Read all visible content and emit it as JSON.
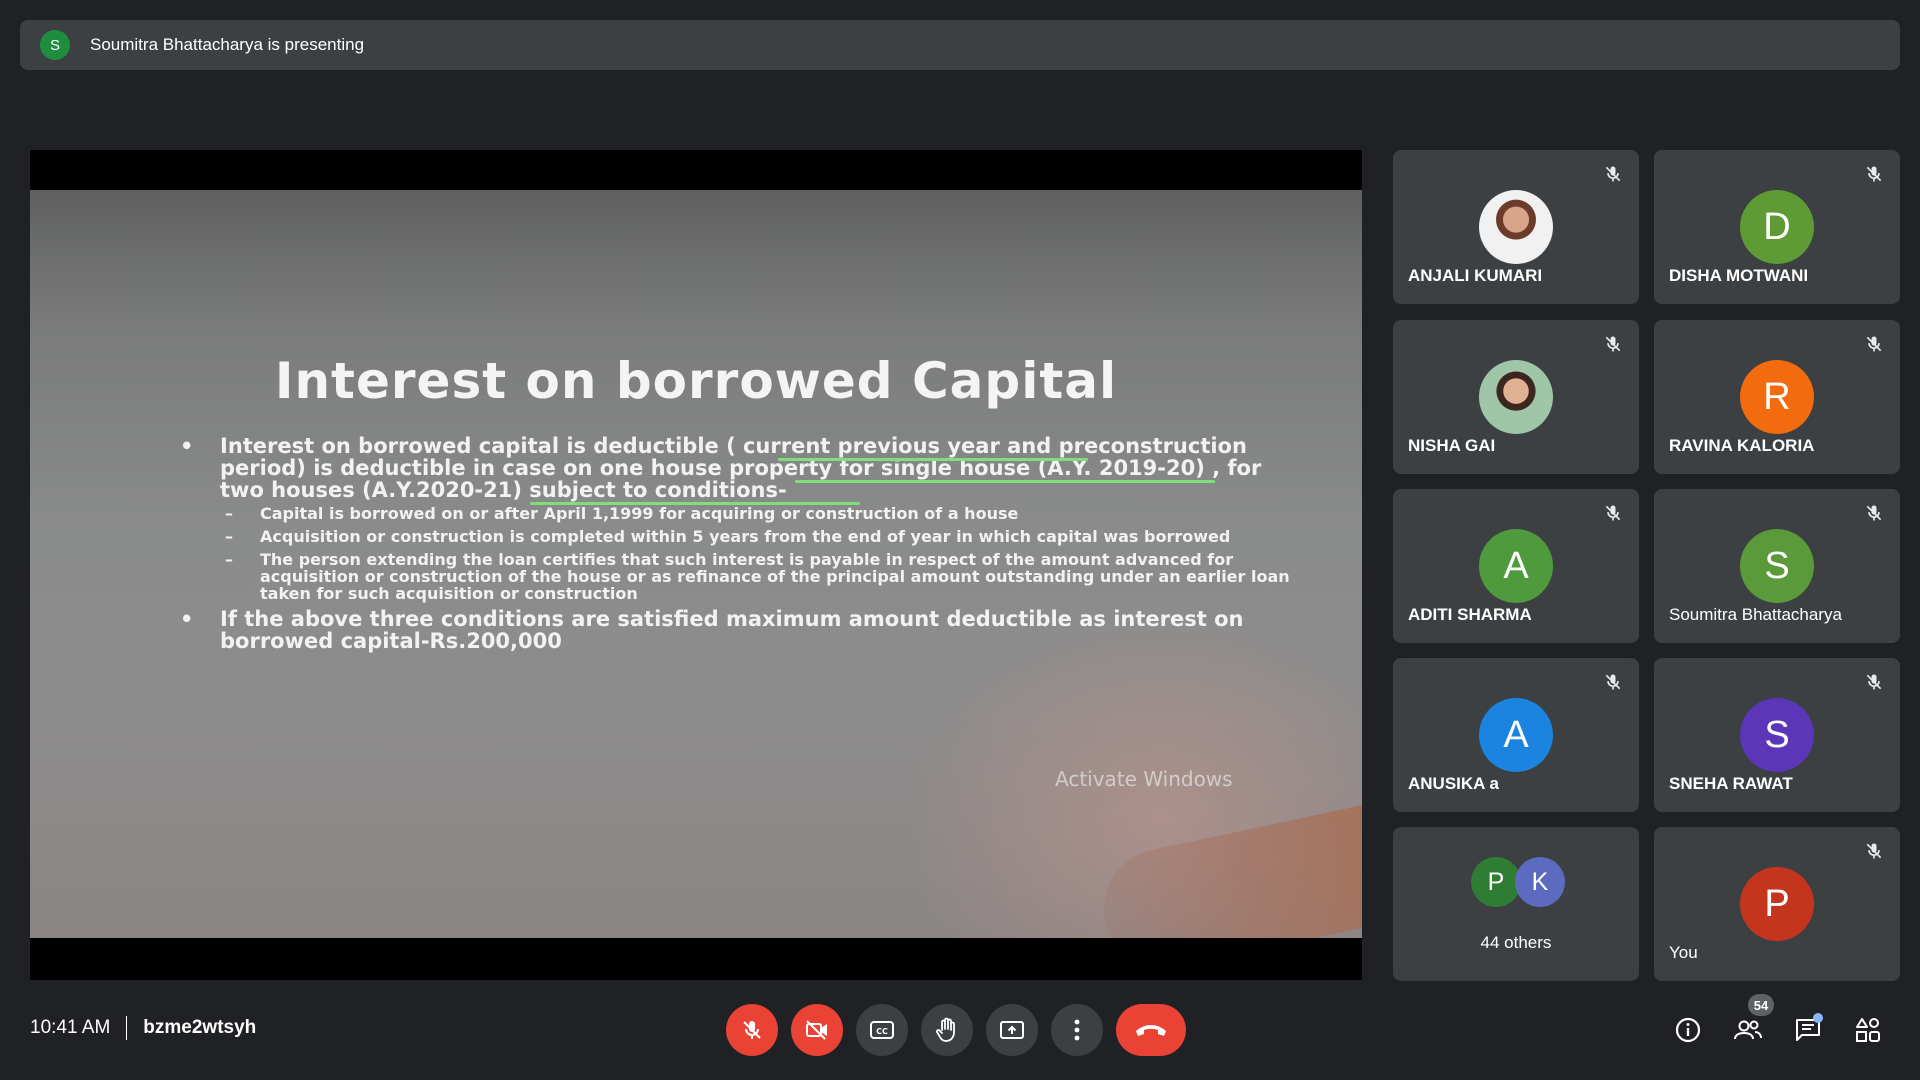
{
  "banner": {
    "avatar_letter": "S",
    "text": "Soumitra Bhattacharya is presenting"
  },
  "slide": {
    "title": "Interest on borrowed Capital",
    "bullets": [
      "Interest on borrowed capital is deductible ( current previous year and preconstruction period) is deductible in case on one house property for single house (A.Y. 2019-20) , for two houses (A.Y.2020-21) subject to conditions-",
      "If the above three conditions are satisfied maximum amount deductible as interest on borrowed capital-Rs.200,000"
    ],
    "subs": [
      "Capital is borrowed on or after April 1,1999 for acquiring or construction of a house",
      "Acquisition or construction is completed within 5 years from the end of year in which capital was borrowed",
      "The person extending the loan certifies that such interest is payable in respect of the amount advanced for acquisition or construction of the house or as refinance of the principal amount outstanding under  an earlier loan taken for such acquisition or construction"
    ],
    "watermark": "Activate Windows"
  },
  "participants": [
    {
      "name": "ANJALI KUMARI",
      "letter": "",
      "color": ""
    },
    {
      "name": "DISHA MOTWANI",
      "letter": "D",
      "color": "#5f9b35"
    },
    {
      "name": "NISHA GAI",
      "letter": "",
      "color": ""
    },
    {
      "name": "RAVINA KALORIA",
      "letter": "R",
      "color": "#f26b0f"
    },
    {
      "name": "ADITI SHARMA",
      "letter": "A",
      "color": "#4e9a3c"
    },
    {
      "name": "Soumitra Bhattacharya",
      "letter": "S",
      "color": "#5b9a3a"
    },
    {
      "name": "ANUSIKA a",
      "letter": "A",
      "color": "#1a84e0"
    },
    {
      "name": "SNEHA RAWAT",
      "letter": "S",
      "color": "#5b36b8"
    },
    {
      "name": "You",
      "letter": "P",
      "color": "#c5341d"
    }
  ],
  "others": {
    "letters": [
      "P",
      "K"
    ],
    "colors": [
      "#2f7d32",
      "#5c6bc0"
    ],
    "label": "44 others"
  },
  "bottom": {
    "time": "10:41 AM",
    "meeting_code": "bzme2wtsyh",
    "people_count": "54"
  },
  "colors": {
    "background": "#202124",
    "tile": "#3c4043",
    "danger": "#ea4335",
    "accent": "#8ab4f8"
  },
  "icons": [
    "mic-off-icon",
    "camera-off-icon",
    "captions-icon",
    "raise-hand-icon",
    "present-icon",
    "more-icon",
    "end-call-icon",
    "info-icon",
    "people-icon",
    "chat-icon",
    "activities-icon"
  ]
}
